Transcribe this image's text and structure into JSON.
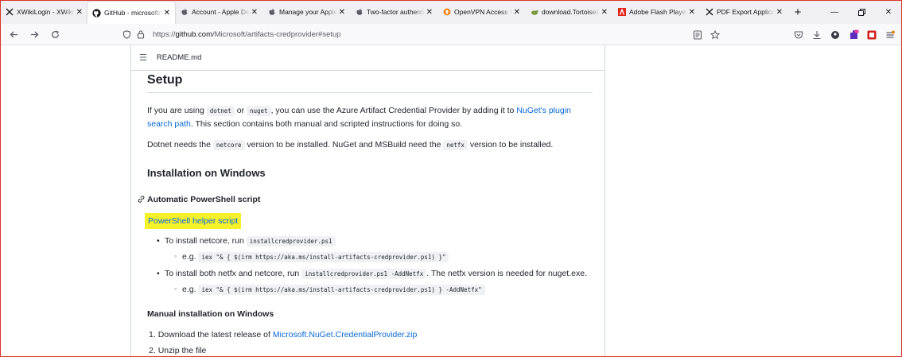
{
  "browser": {
    "tabs": [
      {
        "title": "XWikiLogin - XWiki",
        "favicon": "x-icon",
        "active": false
      },
      {
        "title": "GitHub - microsoft/a",
        "favicon": "github-icon",
        "active": true
      },
      {
        "title": "Account - Apple Dev",
        "favicon": "apple-icon",
        "active": false
      },
      {
        "title": "Manage your Apple ID",
        "favicon": "apple-icon",
        "active": false
      },
      {
        "title": "Two-factor authentica",
        "favicon": "apple-icon",
        "active": false
      },
      {
        "title": "OpenVPN Access Serv",
        "favicon": "openvpn-icon",
        "active": false
      },
      {
        "title": "download.TortoiseGit",
        "favicon": "tortoise-icon",
        "active": false
      },
      {
        "title": "Adobe Flash Player E",
        "favicon": "adobe-icon",
        "active": false
      },
      {
        "title": "PDF Export Applicatio",
        "favicon": "x-icon",
        "active": false
      }
    ],
    "url": {
      "scheme": "https://",
      "host": "github.com",
      "path": "/Microsoft/artifacts-credprovider#setup"
    }
  },
  "readme": {
    "filename": "README.md",
    "setup_heading": "Setup",
    "p1": {
      "before": "If you are using ",
      "code1": "dotnet",
      "or": " or ",
      "code2": "nuget",
      "middle": ", you can use the Azure Artifact Credential Provider by adding it to ",
      "link": "NuGet's plugin search path",
      "after": ". This section contains both manual and scripted instructions for doing so."
    },
    "p2": {
      "before": "Dotnet needs the ",
      "code1": "netcore",
      "middle": " version to be installed. NuGet and MSBuild need the ",
      "code2": "netfx",
      "after": " version to be installed."
    },
    "install_windows_heading": "Installation on Windows",
    "auto_heading": "Automatic PowerShell script",
    "helper_link": "PowerShell helper script",
    "bullet1": {
      "text": "To install netcore, run ",
      "code": "installcredprovider.ps1",
      "eg": "e.g. ",
      "eg_code": "iex \"& { $(irm https://aka.ms/install-artifacts-credprovider.ps1) }\""
    },
    "bullet2": {
      "text": "To install both netfx and netcore, run ",
      "code": "installcredprovider.ps1 -AddNetfx",
      "after": ". The netfx version is needed for nuget.exe.",
      "eg": "e.g. ",
      "eg_code": "iex \"& { $(irm https://aka.ms/install-artifacts-credprovider.ps1) } -AddNetfx\""
    },
    "manual_heading": "Manual installation on Windows",
    "step1": {
      "num": "1. ",
      "text": "Download the latest release of ",
      "link": "Microsoft.NuGet.CredentialProvider.zip"
    },
    "step2": {
      "num": "2. ",
      "text": "Unzip the file"
    }
  }
}
